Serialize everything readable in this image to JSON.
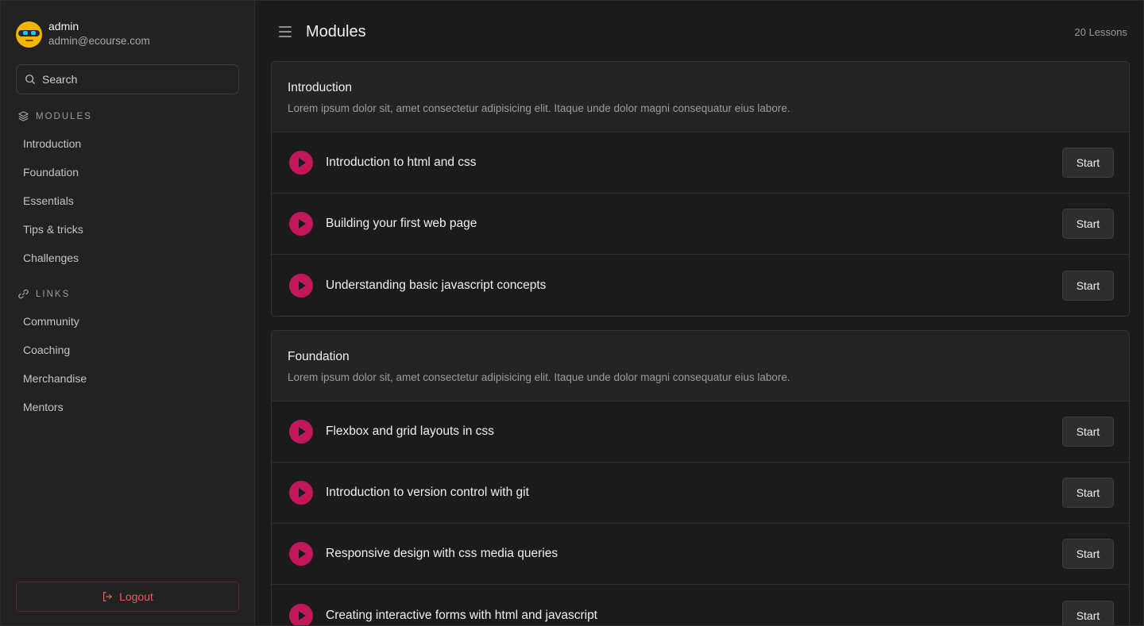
{
  "user": {
    "name": "admin",
    "email": "admin@ecourse.com"
  },
  "search": {
    "placeholder": "Search",
    "icon": "search-icon"
  },
  "sidebar": {
    "modules_heading": "MODULES",
    "modules": [
      {
        "label": "Introduction"
      },
      {
        "label": "Foundation"
      },
      {
        "label": "Essentials"
      },
      {
        "label": "Tips & tricks"
      },
      {
        "label": "Challenges"
      }
    ],
    "links_heading": "LINKS",
    "links": [
      {
        "label": "Community"
      },
      {
        "label": "Coaching"
      },
      {
        "label": "Merchandise"
      },
      {
        "label": "Mentors"
      }
    ],
    "logout_label": "Logout"
  },
  "header": {
    "title": "Modules",
    "lessons_count": "20 Lessons"
  },
  "modules": [
    {
      "title": "Introduction",
      "description": "Lorem ipsum dolor sit, amet consectetur adipisicing elit. Itaque unde dolor magni consequatur eius labore.",
      "lessons": [
        {
          "title": "Introduction to html and css",
          "action": "Start"
        },
        {
          "title": "Building your first web page",
          "action": "Start"
        },
        {
          "title": "Understanding basic javascript concepts",
          "action": "Start"
        }
      ]
    },
    {
      "title": "Foundation",
      "description": "Lorem ipsum dolor sit, amet consectetur adipisicing elit. Itaque unde dolor magni consequatur eius labore.",
      "lessons": [
        {
          "title": "Flexbox and grid layouts in css",
          "action": "Start"
        },
        {
          "title": "Introduction to version control with git",
          "action": "Start"
        },
        {
          "title": "Responsive design with css media queries",
          "action": "Start"
        },
        {
          "title": "Creating interactive forms with html and javascript",
          "action": "Start"
        }
      ]
    }
  ],
  "colors": {
    "accent": "#c2185b",
    "danger": "#ef5a5a",
    "background": "#1b1b1b",
    "sidebar": "#222222"
  }
}
